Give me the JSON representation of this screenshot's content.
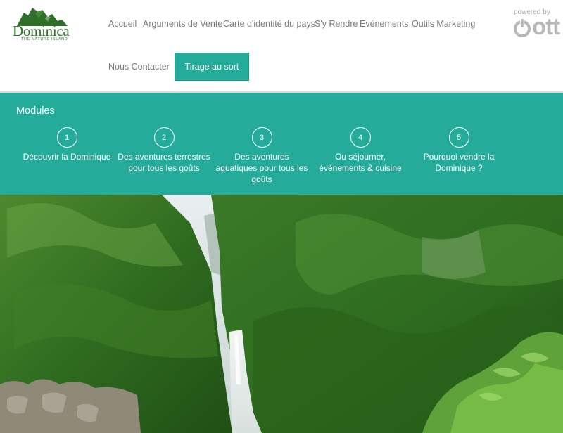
{
  "brand": {
    "name": "Dominica",
    "tagline": "THE NATURE ISLAND"
  },
  "nav": {
    "items": [
      "Accueil",
      "Arguments de Vente",
      "Carte d'identité du pays",
      "S'y Rendre",
      "Evénements",
      "Outils Marketing",
      "Nous Contacter"
    ],
    "cta_label": "Tirage au sort"
  },
  "powered": {
    "label": "powered by",
    "brand": "ott"
  },
  "modules": {
    "title": "Modules",
    "items": [
      {
        "number": "1",
        "label": "Découvrir la Dominique"
      },
      {
        "number": "2",
        "label": "Des aventures terrestres pour tous les goûts"
      },
      {
        "number": "3",
        "label": "Des aventures aquatiques pour tous les goûts"
      },
      {
        "number": "4",
        "label": "Ou séjourner, événements & cuisine"
      },
      {
        "number": "5",
        "label": "Pourquoi vendre la Dominique ?"
      }
    ]
  },
  "colors": {
    "accent": "#25ab99",
    "nav_text": "#7a7a7a",
    "logo_green": "#2f6f2a"
  },
  "hero": {
    "icon": "rainforest-waterfall-photo"
  }
}
